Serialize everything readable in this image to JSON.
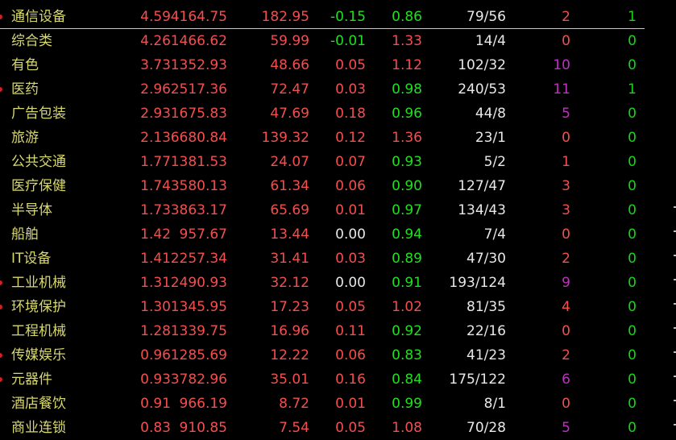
{
  "board": {
    "rows": [
      {
        "name": "通信设备",
        "chg": "4.59",
        "chg_color": "red",
        "index": "4164.75",
        "amount": "182.95",
        "speed": "-0.15",
        "speed_color": "green",
        "vol_ratio": "0.86",
        "vr_color": "green",
        "up_down": "79/56",
        "limit_up": "2",
        "lu_color": "red",
        "limit_down": "1",
        "selected": true,
        "marker": true
      },
      {
        "name": "综合类",
        "chg": "4.26",
        "chg_color": "red",
        "index": "1466.62",
        "amount": "59.99",
        "speed": "-0.01",
        "speed_color": "green",
        "vol_ratio": "1.33",
        "vr_color": "red",
        "up_down": "14/4",
        "limit_up": "0",
        "lu_color": "red",
        "limit_down": "0",
        "selected": false,
        "marker": false
      },
      {
        "name": "有色",
        "chg": "3.73",
        "chg_color": "red",
        "index": "1352.93",
        "amount": "48.66",
        "speed": "0.05",
        "speed_color": "red",
        "vol_ratio": "1.12",
        "vr_color": "red",
        "up_down": "102/32",
        "limit_up": "10",
        "lu_color": "purple",
        "limit_down": "0",
        "selected": false,
        "marker": false
      },
      {
        "name": "医药",
        "chg": "2.96",
        "chg_color": "red",
        "index": "2517.36",
        "amount": "72.47",
        "speed": "0.03",
        "speed_color": "red",
        "vol_ratio": "0.98",
        "vr_color": "green",
        "up_down": "240/53",
        "limit_up": "11",
        "lu_color": "purple",
        "limit_down": "1",
        "selected": false,
        "marker": true
      },
      {
        "name": "广告包装",
        "chg": "2.93",
        "chg_color": "red",
        "index": "1675.83",
        "amount": "47.69",
        "speed": "0.18",
        "speed_color": "red",
        "vol_ratio": "0.96",
        "vr_color": "green",
        "up_down": "44/8",
        "limit_up": "5",
        "lu_color": "purple",
        "limit_down": "0",
        "selected": false,
        "marker": false
      },
      {
        "name": "旅游",
        "chg": "2.13",
        "chg_color": "red",
        "index": "6680.84",
        "amount": "139.32",
        "speed": "0.12",
        "speed_color": "red",
        "vol_ratio": "1.36",
        "vr_color": "red",
        "up_down": "23/1",
        "limit_up": "0",
        "lu_color": "red",
        "limit_down": "0",
        "selected": false,
        "marker": false
      },
      {
        "name": "公共交通",
        "chg": "1.77",
        "chg_color": "red",
        "index": "1381.53",
        "amount": "24.07",
        "speed": "0.07",
        "speed_color": "red",
        "vol_ratio": "0.93",
        "vr_color": "green",
        "up_down": "5/2",
        "limit_up": "1",
        "lu_color": "red",
        "limit_down": "0",
        "selected": false,
        "marker": false
      },
      {
        "name": "医疗保健",
        "chg": "1.74",
        "chg_color": "red",
        "index": "3580.13",
        "amount": "61.34",
        "speed": "0.06",
        "speed_color": "red",
        "vol_ratio": "0.90",
        "vr_color": "green",
        "up_down": "127/47",
        "limit_up": "3",
        "lu_color": "red",
        "limit_down": "0",
        "selected": false,
        "marker": false
      },
      {
        "name": "半导体",
        "chg": "1.73",
        "chg_color": "red",
        "index": "3863.17",
        "amount": "65.69",
        "speed": "0.01",
        "speed_color": "red",
        "vol_ratio": "0.97",
        "vr_color": "green",
        "up_down": "134/43",
        "limit_up": "3",
        "lu_color": "red",
        "limit_down": "0",
        "selected": false,
        "marker": false
      },
      {
        "name": "船舶",
        "chg": "1.42",
        "chg_color": "red",
        "index": "957.67",
        "amount": "13.44",
        "speed": "0.00",
        "speed_color": "white",
        "vol_ratio": "0.94",
        "vr_color": "green",
        "up_down": "7/4",
        "limit_up": "0",
        "lu_color": "red",
        "limit_down": "0",
        "selected": false,
        "marker": false
      },
      {
        "name": "IT设备",
        "chg": "1.41",
        "chg_color": "red",
        "index": "2257.34",
        "amount": "31.41",
        "speed": "0.03",
        "speed_color": "red",
        "vol_ratio": "0.89",
        "vr_color": "green",
        "up_down": "47/30",
        "limit_up": "2",
        "lu_color": "red",
        "limit_down": "0",
        "selected": false,
        "marker": false
      },
      {
        "name": "工业机械",
        "chg": "1.31",
        "chg_color": "red",
        "index": "2490.93",
        "amount": "32.12",
        "speed": "0.00",
        "speed_color": "white",
        "vol_ratio": "0.91",
        "vr_color": "green",
        "up_down": "193/124",
        "limit_up": "9",
        "lu_color": "purple",
        "limit_down": "0",
        "selected": false,
        "marker": true
      },
      {
        "name": "环境保护",
        "chg": "1.30",
        "chg_color": "red",
        "index": "1345.95",
        "amount": "17.23",
        "speed": "0.05",
        "speed_color": "red",
        "vol_ratio": "1.02",
        "vr_color": "red",
        "up_down": "81/35",
        "limit_up": "4",
        "lu_color": "red",
        "limit_down": "0",
        "selected": false,
        "marker": true
      },
      {
        "name": "工程机械",
        "chg": "1.28",
        "chg_color": "red",
        "index": "1339.75",
        "amount": "16.96",
        "speed": "0.11",
        "speed_color": "red",
        "vol_ratio": "0.92",
        "vr_color": "green",
        "up_down": "22/16",
        "limit_up": "0",
        "lu_color": "red",
        "limit_down": "0",
        "selected": false,
        "marker": false
      },
      {
        "name": "传媒娱乐",
        "chg": "0.96",
        "chg_color": "red",
        "index": "1285.69",
        "amount": "12.22",
        "speed": "0.06",
        "speed_color": "red",
        "vol_ratio": "0.83",
        "vr_color": "green",
        "up_down": "41/23",
        "limit_up": "2",
        "lu_color": "red",
        "limit_down": "0",
        "selected": false,
        "marker": true
      },
      {
        "name": "元器件",
        "chg": "0.93",
        "chg_color": "red",
        "index": "3782.96",
        "amount": "35.01",
        "speed": "0.16",
        "speed_color": "red",
        "vol_ratio": "0.84",
        "vr_color": "green",
        "up_down": "175/122",
        "limit_up": "6",
        "lu_color": "purple",
        "limit_down": "0",
        "selected": false,
        "marker": true
      },
      {
        "name": "酒店餐饮",
        "chg": "0.91",
        "chg_color": "red",
        "index": "966.19",
        "amount": "8.72",
        "speed": "0.01",
        "speed_color": "red",
        "vol_ratio": "0.99",
        "vr_color": "green",
        "up_down": "8/1",
        "limit_up": "0",
        "lu_color": "red",
        "limit_down": "0",
        "selected": false,
        "marker": false
      },
      {
        "name": "商业连锁",
        "chg": "0.83",
        "chg_color": "red",
        "index": "910.85",
        "amount": "7.54",
        "speed": "0.05",
        "speed_color": "red",
        "vol_ratio": "1.08",
        "vr_color": "red",
        "up_down": "70/28",
        "limit_up": "5",
        "lu_color": "purple",
        "limit_down": "0",
        "selected": false,
        "marker": false
      }
    ]
  }
}
